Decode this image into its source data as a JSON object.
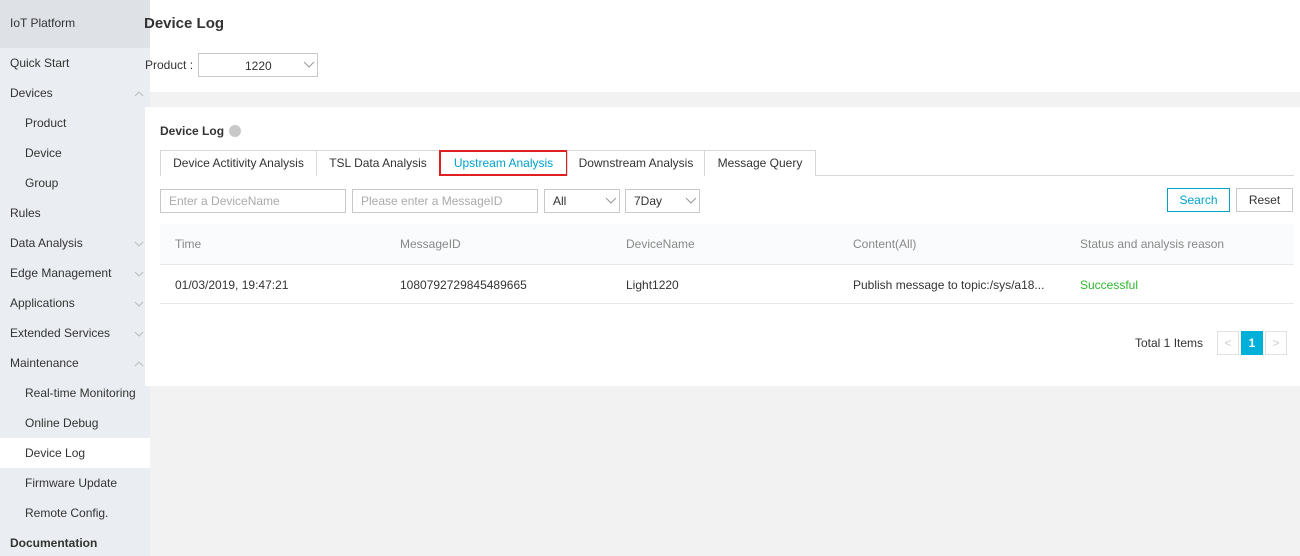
{
  "sidebar": {
    "header": "IoT Platform",
    "items": [
      {
        "label": "Quick Start"
      },
      {
        "label": "Devices"
      },
      {
        "label": "Product"
      },
      {
        "label": "Device"
      },
      {
        "label": "Group"
      },
      {
        "label": "Rules"
      },
      {
        "label": "Data Analysis"
      },
      {
        "label": "Edge Management"
      },
      {
        "label": "Applications"
      },
      {
        "label": "Extended Services"
      },
      {
        "label": "Maintenance"
      },
      {
        "label": "Real-time Monitoring"
      },
      {
        "label": "Online Debug"
      },
      {
        "label": "Device Log"
      },
      {
        "label": "Firmware Update"
      },
      {
        "label": "Remote Config."
      },
      {
        "label": "Documentation"
      }
    ]
  },
  "header": {
    "title": "Device Log",
    "product_label": "Product :",
    "product_value": "1220"
  },
  "card": {
    "title": "Device Log",
    "tabs": [
      {
        "label": "Device Actitivity Analysis"
      },
      {
        "label": "TSL Data Analysis"
      },
      {
        "label": "Upstream Analysis"
      },
      {
        "label": "Downstream Analysis"
      },
      {
        "label": "Message Query"
      }
    ],
    "filters": {
      "device_placeholder": "Enter a DeviceName",
      "message_placeholder": "Please enter a MessageID",
      "type_value": "All",
      "range_value": "7Day",
      "search_label": "Search",
      "reset_label": "Reset"
    },
    "table": {
      "columns": [
        "Time",
        "MessageID",
        "DeviceName",
        "Content(All)",
        "Status and analysis reason"
      ],
      "rows": [
        [
          "01/03/2019, 19:47:21",
          "1080792729845489665",
          "Light1220",
          "Publish message to topic:/sys/a18...",
          "Successful"
        ]
      ]
    },
    "pagination": {
      "total": "Total 1 Items",
      "prev": "<",
      "current": "1",
      "next": ">"
    }
  },
  "colors": {
    "accent": "#00a2ca",
    "success": "#2eb82e",
    "highlight_border": "#e02020"
  }
}
